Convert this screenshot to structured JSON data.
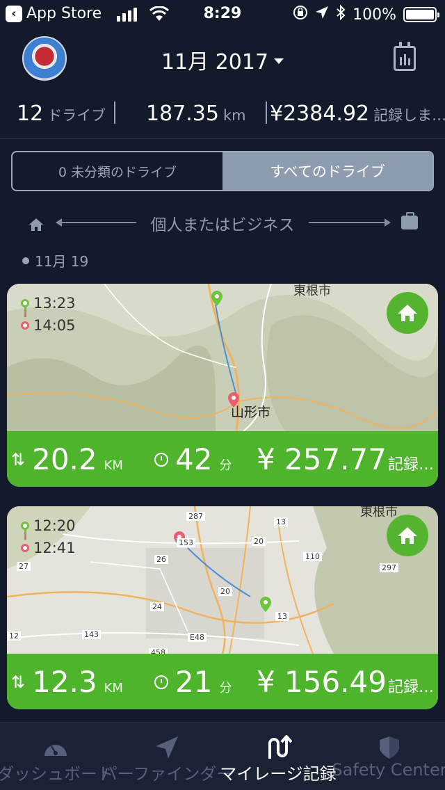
{
  "status_bar": {
    "back_label": "App Store",
    "time": "8:29",
    "battery": "100%"
  },
  "header": {
    "month_title": "11月 2017",
    "avatar_icon": "profile-avatar",
    "calendar_icon": "calendar-stats-icon"
  },
  "stats": {
    "drives_count": "12",
    "drives_label": "ドライブ",
    "distance_value": "187.35",
    "distance_unit": "km",
    "amount_value": "¥2384.92",
    "amount_label": "記録しま…"
  },
  "segment": {
    "unclassified_label": "0 未分類のドライブ",
    "all_label": "すべてのドライブ"
  },
  "classify": {
    "label": "個人またはビジネス",
    "left_icon": "home-icon",
    "right_icon": "briefcase-icon"
  },
  "date_header": "11月 19",
  "drives": [
    {
      "start_time": "13:23",
      "end_time": "14:05",
      "map_labels": {
        "city_top": "東根市",
        "city_main": "山形市"
      },
      "distance": "20.2",
      "distance_unit": "KM",
      "duration": "42",
      "duration_unit": "分",
      "cost": "¥ 257.77",
      "record_label": "記録…",
      "category_icon": "home-icon"
    },
    {
      "start_time": "12:20",
      "end_time": "12:41",
      "map_labels": {
        "city_top": "東根市",
        "road_287": "287",
        "road_13a": "13",
        "road_20a": "20",
        "road_110": "110",
        "road_26": "26",
        "road_27": "27",
        "road_297": "297",
        "road_20b": "20",
        "road_24": "24",
        "road_13b": "13",
        "road_12": "12",
        "road_143": "143",
        "road_e48": "E48",
        "road_458": "458",
        "road_153": "153"
      },
      "distance": "12.3",
      "distance_unit": "KM",
      "duration": "21",
      "duration_unit": "分",
      "cost": "¥ 156.49",
      "record_label": "記録…",
      "category_icon": "home-icon"
    }
  ],
  "tabs": [
    {
      "label": "ダッシュボード",
      "icon": "speedometer-icon",
      "active": false
    },
    {
      "label": "パーファインダー",
      "icon": "navigation-arrow-icon",
      "active": false
    },
    {
      "label": "マイレージ記録",
      "icon": "mileage-route-icon",
      "active": true
    },
    {
      "label": "Safety Center",
      "icon": "shield-icon",
      "active": false
    }
  ],
  "colors": {
    "background": "#131a2b",
    "accent_green": "#4eb42c",
    "segment_active": "#8e9cb0",
    "start_pin": "#6cc43f",
    "end_pin": "#e8606e"
  }
}
